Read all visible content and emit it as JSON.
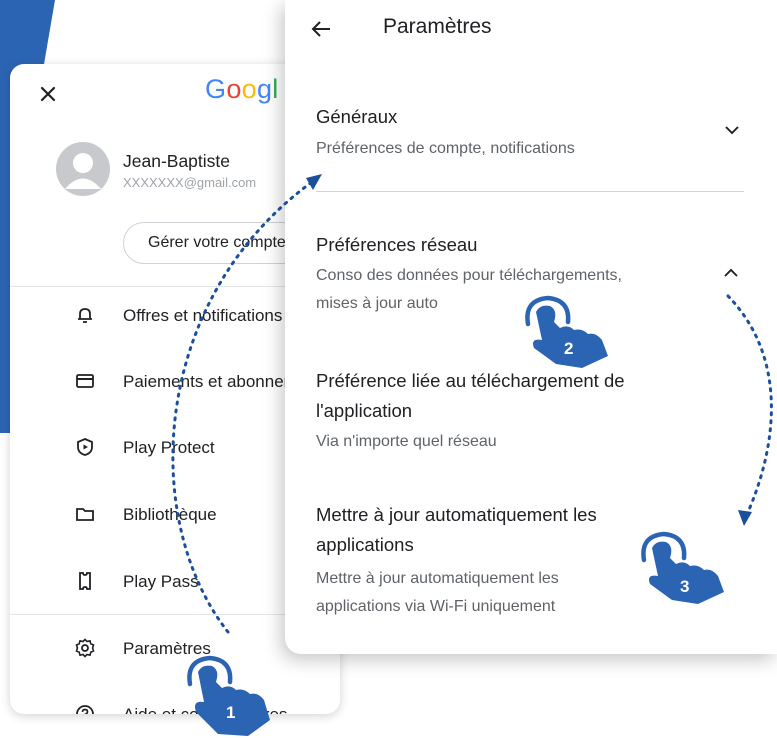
{
  "menu": {
    "logo_text": "Googl",
    "user_name": "Jean-Baptiste",
    "user_email": "XXXXXXX@gmail.com",
    "manage_label": "Gérer votre compte",
    "items": [
      {
        "label": "Offres et notifications",
        "icon": "bell-icon"
      },
      {
        "label": "Paiements et abonnements",
        "icon": "card-icon"
      },
      {
        "label": "Play Protect",
        "icon": "shield-play-icon"
      },
      {
        "label": "Bibliothèque",
        "icon": "folder-icon"
      },
      {
        "label": "Play Pass",
        "icon": "ticket-icon"
      },
      {
        "label": "Paramètres",
        "icon": "gear-icon"
      },
      {
        "label": "Aide et commentaires",
        "icon": "help-icon"
      }
    ]
  },
  "settings": {
    "title": "Paramètres",
    "sections": [
      {
        "title": "Généraux",
        "subtitle": "Préférences de compte, notifications"
      },
      {
        "title": "Préférences réseau",
        "subtitle_line1": "Conso des données pour téléchargements,",
        "subtitle_line2": "mises à jour auto"
      },
      {
        "title_line1": "Préférence liée au téléchargement de",
        "title_line2": "l'application",
        "subtitle": "Via n'importe quel réseau"
      },
      {
        "title_line1": "Mettre à jour automatiquement les",
        "title_line2": "applications",
        "subtitle_line1": "Mettre à jour automatiquement les",
        "subtitle_line2": "applications via Wi-Fi uniquement"
      }
    ]
  },
  "steps": [
    "1",
    "2",
    "3"
  ],
  "colors": {
    "accent_blue": "#2c64b4",
    "arrow_blue": "#1a4f9c",
    "text": "#202124",
    "subtext": "#5f6368"
  }
}
